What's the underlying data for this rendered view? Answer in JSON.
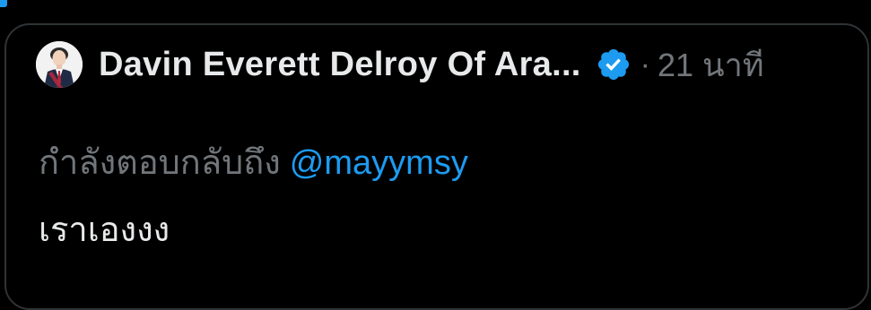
{
  "tweet": {
    "author": {
      "display_name": "Davin Everett Delroy Of Ara...",
      "verified": true,
      "avatar_icon": "profile-photo"
    },
    "separator": "·",
    "time_ago": "21 นาที",
    "reply_prefix": "กำลังตอบกลับถึง",
    "reply_handle": "@mayymsy",
    "body": "เราเองงง"
  },
  "colors": {
    "background": "#000000",
    "border": "#2f3336",
    "primary_text": "#e7e9ea",
    "secondary_text": "#71767b",
    "accent_blue": "#1d9bf0"
  }
}
